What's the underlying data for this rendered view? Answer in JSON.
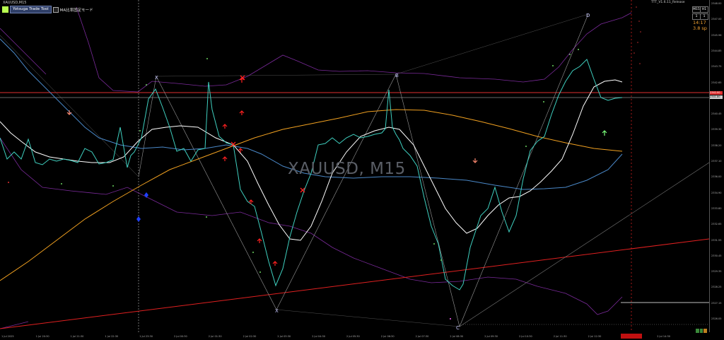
{
  "window": {
    "symbol_label": "XAUUSD,M15",
    "watermark": "XAUUSD, M15",
    "ea_name": "TTT_V1.6.11_Release"
  },
  "toolbar": {
    "tool_button": "Yotsuga Trade Tool",
    "checkbox_label": "MA比率固定モード"
  },
  "timeframe_buttons": [
    "M15",
    "H1",
    "1",
    "1"
  ],
  "status": {
    "countdown": "14:17",
    "spread": "3.8 sp"
  },
  "price_scale": {
    "ticks": [
      "2348.00",
      "2347.00",
      "2345.96",
      "2344.85",
      "2343.75",
      "2342.65",
      "2341.55",
      "2340.45",
      "2339.30",
      "2338.20",
      "2337.10",
      "2336.00",
      "2334.90",
      "2333.80",
      "2332.65",
      "2331.55",
      "2330.45",
      "2329.35",
      "2328.25",
      "2327.15",
      "2326.05"
    ],
    "current_price_tag": "2342.00",
    "secondary_price_tag": "2341.80"
  },
  "time_axis": {
    "labels": [
      "1 Jul 2025",
      "1 Jul 20:30",
      "1 Jul 21:30",
      "1 Jul 22:30",
      "1 Jul 23:30",
      "2 Jul 00:30",
      "2 Jul 01:30",
      "2 Jul 02:30",
      "2 Jul 03:30",
      "2 Jul 04:30",
      "2 Jul 05:30",
      "2 Jul 06:30",
      "2 Jul 07:30",
      "2 Jul 08:30",
      "2 Jul 09:30",
      "2 Jul 10:30",
      "2 Jul 11:30",
      "2 Jul 12:30",
      "2 Jul 13:30",
      "2 Jul 14:30"
    ]
  },
  "pattern_points": [
    "X",
    "X",
    "B",
    "C",
    "D"
  ],
  "colors": {
    "background": "#000000",
    "price_line": "#3fd0c0",
    "ma_fast": "#ffffff",
    "ma_slow": "#f0a020",
    "ma_blue": "#4a88c8",
    "bands": "#7a2a9a",
    "trendline": "#e02020",
    "horizontal_price": "#e03030",
    "arrow_red": "#ff2020",
    "arrow_salmon": "#ff8a70",
    "arrow_green": "#7aff7a"
  },
  "icons": {
    "up_arrow": "up-arrow-icon",
    "down_arrow": "down-arrow-icon",
    "cross": "cross-icon"
  }
}
